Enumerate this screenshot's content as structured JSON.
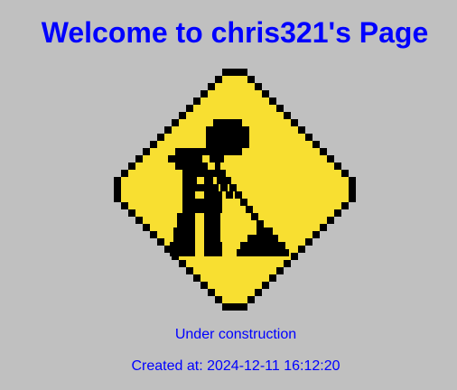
{
  "page": {
    "title": "Welcome to chris321's Page",
    "status": "Under construction",
    "created_at": "Created at: 2024-12-11 16:12:20"
  },
  "image": {
    "icon": "under-construction-sign-icon",
    "colors": {
      "sign": "#f8df31",
      "outline": "#000000",
      "background": "#c0c0c0",
      "text": "#0000ff"
    }
  }
}
